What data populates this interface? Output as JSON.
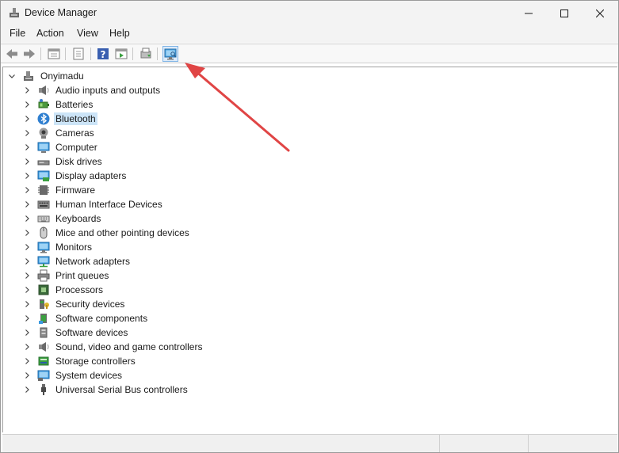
{
  "window": {
    "title": "Device Manager"
  },
  "menu": [
    "File",
    "Action",
    "View",
    "Help"
  ],
  "toolbar": {
    "buttons": [
      "back-icon",
      "forward-icon",
      "properties-view-icon",
      "properties-icon",
      "help-icon",
      "run-icon",
      "update-driver-icon",
      "scan-hardware-icon"
    ]
  },
  "tree": {
    "root": "Onyimadu",
    "selected": "Bluetooth",
    "items": [
      {
        "label": "Audio inputs and outputs",
        "icon": "speaker-icon"
      },
      {
        "label": "Batteries",
        "icon": "battery-icon"
      },
      {
        "label": "Bluetooth",
        "icon": "bluetooth-icon"
      },
      {
        "label": "Cameras",
        "icon": "camera-icon"
      },
      {
        "label": "Computer",
        "icon": "computer-icon"
      },
      {
        "label": "Disk drives",
        "icon": "disk-drive-icon"
      },
      {
        "label": "Display adapters",
        "icon": "display-adapter-icon"
      },
      {
        "label": "Firmware",
        "icon": "firmware-icon"
      },
      {
        "label": "Human Interface Devices",
        "icon": "hid-icon"
      },
      {
        "label": "Keyboards",
        "icon": "keyboard-icon"
      },
      {
        "label": "Mice and other pointing devices",
        "icon": "mouse-icon"
      },
      {
        "label": "Monitors",
        "icon": "monitor-icon"
      },
      {
        "label": "Network adapters",
        "icon": "network-adapter-icon"
      },
      {
        "label": "Print queues",
        "icon": "printer-icon"
      },
      {
        "label": "Processors",
        "icon": "processor-icon"
      },
      {
        "label": "Security devices",
        "icon": "security-device-icon"
      },
      {
        "label": "Software components",
        "icon": "software-component-icon"
      },
      {
        "label": "Software devices",
        "icon": "software-device-icon"
      },
      {
        "label": "Sound, video and game controllers",
        "icon": "sound-controller-icon"
      },
      {
        "label": "Storage controllers",
        "icon": "storage-controller-icon"
      },
      {
        "label": "System devices",
        "icon": "system-device-icon"
      },
      {
        "label": "Universal Serial Bus controllers",
        "icon": "usb-icon"
      }
    ]
  },
  "colors": {
    "selection": "#cce4f7",
    "accent": "#0078d4",
    "annotation_arrow": "#e04545"
  }
}
